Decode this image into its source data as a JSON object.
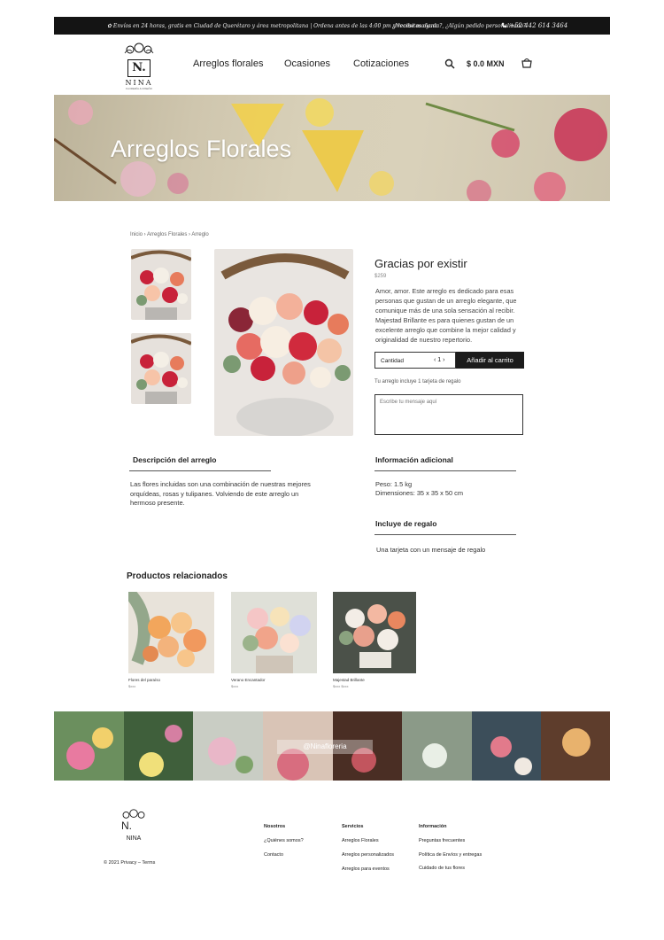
{
  "topbar": {
    "shipping": "✿ Envíos en 24 horas, gratis en Ciudad de Querétaro y área metropolitana  |  Ordena antes de las 4:00 pm y recibe mañana",
    "help": "¿Necesitas ayuda?, ¿Algún pedido personalizado?",
    "phone_icon": "phone-icon",
    "phone": "+52 442 614 3464"
  },
  "logo": {
    "letter": "N.",
    "name": "NINA",
    "tagline": "FLORERÍA & DISEÑO"
  },
  "nav": {
    "items": [
      "Arreglos florales",
      "Ocasiones",
      "Cotizaciones"
    ]
  },
  "cart": {
    "total": "$ 0.0 MXN",
    "icon": "basket-icon",
    "search_icon": "search-icon"
  },
  "hero": {
    "title": "Arreglos Florales"
  },
  "breadcrumb": "Inicio › Arreglos Florales › Arreglo",
  "product": {
    "title": "Gracias por existir",
    "price": "$259",
    "description": "Amor, amor. Este arreglo es dedicado para esas personas que gustan de un arreglo elegante, que comunique más de una sola sensación al recibir. Majestad Brillante es para quienes gustan de un excelente arreglo que combine la mejor calidad y originalidad de nuestro repertorio.",
    "qty_label": "Cantidad",
    "qty_value": "1",
    "add_to_cart": "Añadir al carrito",
    "gift_note": "Tu arreglo incluye 1 tarjeta de regalo",
    "gift_placeholder": "Escribe tu mensaje aquí"
  },
  "sections": {
    "desc_title": "Descripción del arreglo",
    "desc_text": "Las flores incluidas son una combinación de nuestras mejores orquídeas, rosas y tulipanes. Volviendo de este arreglo un hermoso presente.",
    "info_title": "Información adicional",
    "weight": "Peso: 1.5 kg",
    "dims": "Dimensiones: 35 x 35 x 50 cm",
    "gift_title": "Incluye de regalo",
    "gift_text": "Una tarjeta con un mensaje de regalo"
  },
  "related": {
    "title": "Productos relacionados",
    "items": [
      {
        "name": "Flores del paraíso",
        "price": "$xxx"
      },
      {
        "name": "Verano Encantador",
        "price": "$xxx"
      },
      {
        "name": "Majestad Brillante",
        "price": "$xxx $xxx"
      }
    ]
  },
  "strip": {
    "overlay": "@Ninafloreria"
  },
  "footer": {
    "copyright": "© 2021    Privacy – Terms",
    "cols": [
      {
        "title": "Nosotros",
        "links": [
          "¿Quiénes somos?",
          "Contacto"
        ]
      },
      {
        "title": "Servicios",
        "links": [
          "Arreglos Florales",
          "Arreglos personalizados",
          "Arreglos para eventos"
        ]
      },
      {
        "title": "Información",
        "links": [
          "Preguntas frecuentes",
          "Política de Envíos y entregas",
          "Cuidado de tus flores"
        ]
      }
    ]
  }
}
